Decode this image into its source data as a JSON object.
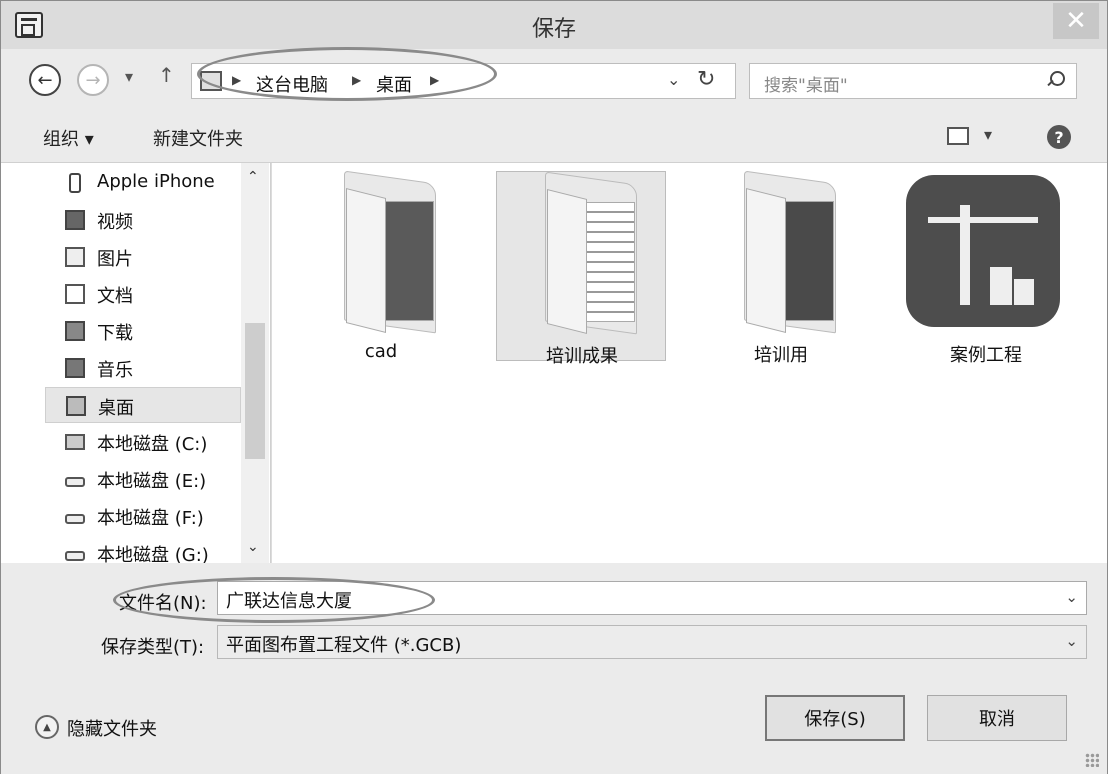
{
  "window": {
    "title": "保存"
  },
  "address": {
    "crumbs": [
      "这台电脑",
      "桌面"
    ],
    "search_placeholder": "搜索\"桌面\""
  },
  "toolbar": {
    "organize": "组织 ▾",
    "new_folder": "新建文件夹"
  },
  "nav": {
    "items": [
      {
        "label": "Apple iPhone",
        "icon": "phone-icon"
      },
      {
        "label": "视频",
        "icon": "video-icon"
      },
      {
        "label": "图片",
        "icon": "picture-icon"
      },
      {
        "label": "文档",
        "icon": "document-icon"
      },
      {
        "label": "下载",
        "icon": "download-icon"
      },
      {
        "label": "音乐",
        "icon": "music-icon"
      },
      {
        "label": "桌面",
        "icon": "desktop-icon",
        "selected": true
      },
      {
        "label": "本地磁盘 (C:)",
        "icon": "system-drive-icon"
      },
      {
        "label": "本地磁盘 (E:)",
        "icon": "drive-icon"
      },
      {
        "label": "本地磁盘 (F:)",
        "icon": "drive-icon"
      },
      {
        "label": "本地磁盘 (G:)",
        "icon": "drive-icon"
      }
    ]
  },
  "files": [
    {
      "label": "cad",
      "icon": "folder-icon"
    },
    {
      "label": "培训成果",
      "icon": "folder-icon",
      "selected": true
    },
    {
      "label": "培训用",
      "icon": "folder-icon"
    },
    {
      "label": "案例工程",
      "icon": "app-icon"
    }
  ],
  "form": {
    "filename_label": "文件名(N):",
    "filename_value": "广联达信息大厦",
    "filetype_label": "保存类型(T):",
    "filetype_value": "平面图布置工程文件 (*.GCB)",
    "hide_folders": "隐藏文件夹",
    "save_button": "保存(S)",
    "cancel_button": "取消"
  }
}
